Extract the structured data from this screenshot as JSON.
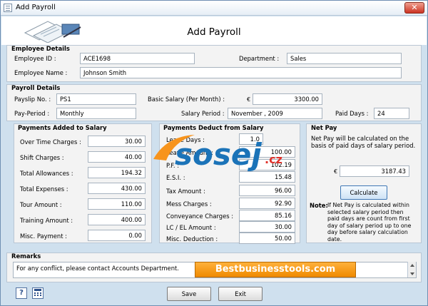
{
  "window": {
    "title": "Add Payroll",
    "close": "✕"
  },
  "header": {
    "title": "Add Payroll"
  },
  "employee": {
    "section": "Employee Details",
    "id_label": "Employee ID :",
    "id_value": "ACE1698",
    "dept_label": "Department :",
    "dept_value": "Sales",
    "name_label": "Employee Name :",
    "name_value": "Johnson Smith"
  },
  "payroll": {
    "section": "Payroll Details",
    "payslip_label": "Payslip No. :",
    "payslip_value": "PS1",
    "basic_label": "Basic Salary (Per Month) :",
    "basic_currency": "€",
    "basic_value": "3300.00",
    "period_label": "Pay-Period :",
    "period_value": "Monthly",
    "salary_period_label": "Salary Period :",
    "salary_period_value": "November , 2009",
    "paid_days_label": "Paid Days :",
    "paid_days_value": "24"
  },
  "added": {
    "section": "Payments Added to Salary",
    "items": [
      {
        "label": "Over Time Charges :",
        "value": "30.00"
      },
      {
        "label": "Shift Charges :",
        "value": "40.00"
      },
      {
        "label": "Total Allowances :",
        "value": "194.32"
      },
      {
        "label": "Total Expenses :",
        "value": "430.00"
      },
      {
        "label": "Tour Amount :",
        "value": "110.00"
      },
      {
        "label": "Training Amount :",
        "value": "400.00"
      },
      {
        "label": "Misc. Payment :",
        "value": "0.00"
      }
    ]
  },
  "deduct": {
    "section": "Payments Deduct from Salary",
    "items": [
      {
        "label": "Leave Days :",
        "value": "1.0"
      },
      {
        "label": "Leave Amount :",
        "value": "100.00"
      },
      {
        "label": "P.F. :",
        "value": "102.19"
      },
      {
        "label": "E.S.I. :",
        "value": "15.48"
      },
      {
        "label": "Tax Amount :",
        "value": "96.00"
      },
      {
        "label": "Mess Charges :",
        "value": "92.90"
      },
      {
        "label": "Conveyance Charges :",
        "value": "85.16"
      },
      {
        "label": "LC / EL Amount :",
        "value": "30.00"
      },
      {
        "label": "Misc. Deduction :",
        "value": "50.00"
      }
    ]
  },
  "netpay": {
    "section": "Net Pay",
    "description": "Net Pay will be calculated on the basis of paid days of salary period.",
    "currency": "€",
    "value": "3187.43",
    "calculate_label": "Calculate",
    "note_label": "Note:",
    "note_text": "If Net Pay is calculated within selected salary period then paid days are count from first day of salary period up to one day before salary calculation date."
  },
  "remarks": {
    "section": "Remarks",
    "value": "For any conflict, please contact Accounts Department."
  },
  "banner": {
    "text": "Bestbusinesstools.com"
  },
  "watermark": {
    "text": "sosej",
    "suffix": ".cz"
  },
  "footer": {
    "help_icon": "?",
    "save_label": "Save",
    "exit_label": "Exit"
  },
  "colors": {
    "accent": "#3f78b5",
    "banner": "#f39200",
    "panel_border": "#b9c6d4"
  }
}
